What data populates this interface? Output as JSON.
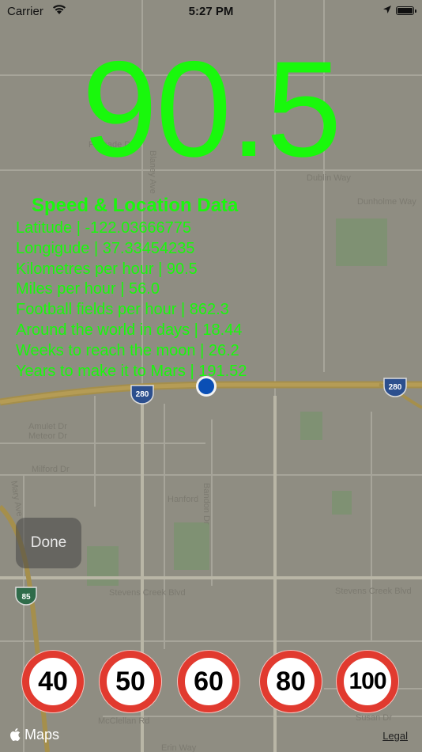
{
  "status_bar": {
    "carrier": "Carrier",
    "time": "5:27 PM"
  },
  "speed": "90.5",
  "data_panel": {
    "title": "Speed & Location Data",
    "lines": [
      "Latitude | -122.03666775",
      "Longigude | 37.33454235",
      "Kilometres per hour | 90.5",
      "Miles per hour | 56.0",
      "Football fields per hour | 862.3",
      "Around the world in days | 18.44",
      "Weeks to reach the moon | 26.2",
      "Years to make it to Mars | 191.52"
    ]
  },
  "done_label": "Done",
  "speed_signs": [
    "40",
    "50",
    "60",
    "80",
    "100"
  ],
  "map": {
    "street_labels": [
      "Palisade Dr",
      "Dublin Way",
      "Dunholme Way",
      "Amulet Dr",
      "Meteor Dr",
      "Milford Dr",
      "Mary Ave",
      "Hanford",
      "Stevens Creek Blvd",
      "Stevens Creek Blvd",
      "McClellan Rd",
      "Erin Way",
      "Blaney Ave",
      "Bandon Dr",
      "Pacifica Dr",
      "Susan Dr"
    ],
    "highway_shields": [
      "280",
      "280",
      "85"
    ],
    "attribution": "Maps",
    "legal": "Legal"
  },
  "colors": {
    "speed_text": "#19f80c",
    "sign_ring": "#e13a2f",
    "map_overlay": "#8f8d82"
  }
}
